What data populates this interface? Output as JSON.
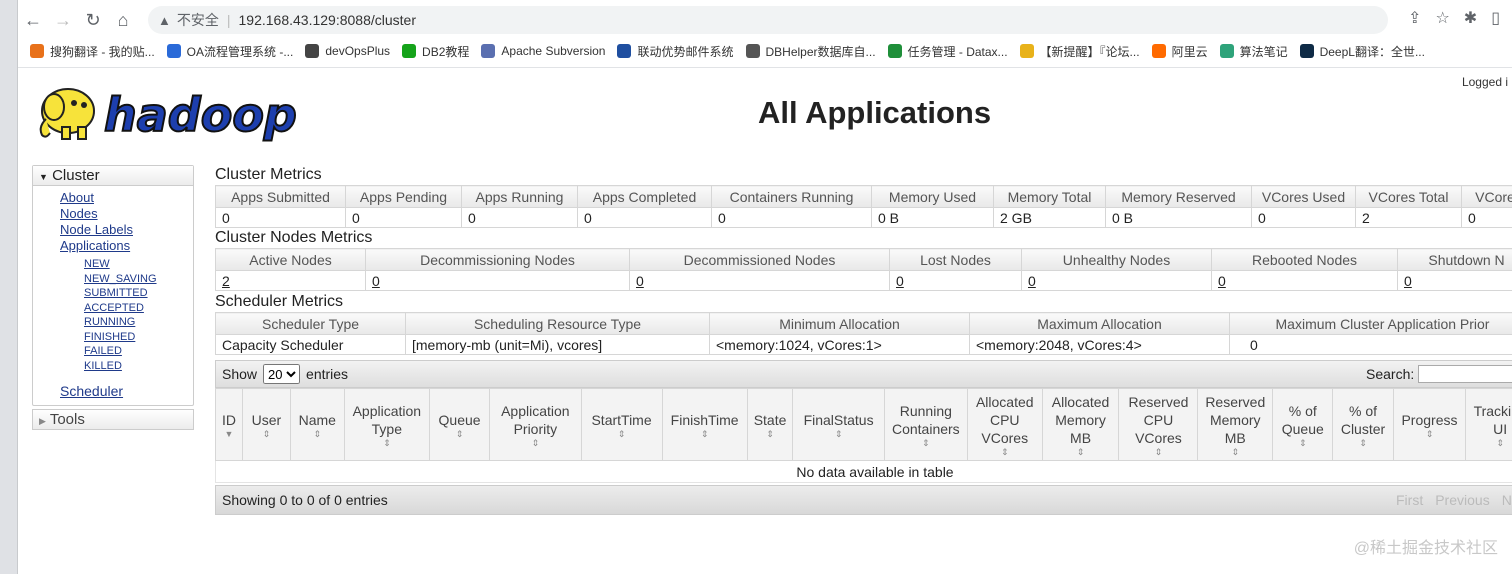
{
  "browser": {
    "security_label": "不安全",
    "url": "192.168.43.129:8088/cluster",
    "bookmarks": [
      {
        "label": "搜狗翻译 - 我的贴...",
        "color": "#e8711a"
      },
      {
        "label": "OA流程管理系统 -...",
        "color": "#2a6ad8"
      },
      {
        "label": "devOpsPlus",
        "color": "#444444"
      },
      {
        "label": "DB2教程",
        "color": "#15a31a"
      },
      {
        "label": "Apache Subversion",
        "color": "#5a6fb0"
      },
      {
        "label": "联动优势邮件系统",
        "color": "#1f4fa0"
      },
      {
        "label": "DBHelper数据库自...",
        "color": "#555555"
      },
      {
        "label": "任务管理 - Datax...",
        "color": "#1f8f3a"
      },
      {
        "label": "【新提醒】『论坛...",
        "color": "#e8b21a"
      },
      {
        "label": "阿里云",
        "color": "#ff6a00"
      },
      {
        "label": "算法笔记",
        "color": "#2ea37a"
      },
      {
        "label": "DeepL翻译：全世...",
        "color": "#0f2b46"
      }
    ]
  },
  "header": {
    "logo_text": "hadoop",
    "logged_in": "Logged i",
    "title": "All Applications"
  },
  "sidebar": {
    "cluster_label": "Cluster",
    "links": [
      "About",
      "Nodes",
      "Node Labels",
      "Applications"
    ],
    "app_states": [
      "NEW",
      "NEW_SAVING",
      "SUBMITTED",
      "ACCEPTED",
      "RUNNING",
      "FINISHED",
      "FAILED",
      "KILLED"
    ],
    "scheduler_label": "Scheduler",
    "tools_label": "Tools"
  },
  "cluster_metrics": {
    "title": "Cluster Metrics",
    "headers": [
      "Apps Submitted",
      "Apps Pending",
      "Apps Running",
      "Apps Completed",
      "Containers Running",
      "Memory Used",
      "Memory Total",
      "Memory Reserved",
      "VCores Used",
      "VCores Total",
      "VCores"
    ],
    "values": [
      "0",
      "0",
      "0",
      "0",
      "0",
      "0 B",
      "2 GB",
      "0 B",
      "0",
      "2",
      "0"
    ]
  },
  "nodes_metrics": {
    "title": "Cluster Nodes Metrics",
    "headers": [
      "Active Nodes",
      "Decommissioning Nodes",
      "Decommissioned Nodes",
      "Lost Nodes",
      "Unhealthy Nodes",
      "Rebooted Nodes",
      "Shutdown N"
    ],
    "values": [
      "2",
      "0",
      "0",
      "0",
      "0",
      "0",
      "0"
    ]
  },
  "scheduler_metrics": {
    "title": "Scheduler Metrics",
    "headers": [
      "Scheduler Type",
      "Scheduling Resource Type",
      "Minimum Allocation",
      "Maximum Allocation",
      "Maximum Cluster Application Prior"
    ],
    "values": [
      "Capacity Scheduler",
      "[memory-mb (unit=Mi), vcores]",
      "<memory:1024, vCores:1>",
      "<memory:2048, vCores:4>",
      "0"
    ]
  },
  "apps_table": {
    "show_label": "Show",
    "page_size": "20",
    "entries_label": "entries",
    "search_label": "Search:",
    "columns": [
      "ID",
      "User",
      "Name",
      "Application Type",
      "Queue",
      "Application Priority",
      "StartTime",
      "FinishTime",
      "State",
      "FinalStatus",
      "Running Containers",
      "Allocated CPU VCores",
      "Allocated Memory MB",
      "Reserved CPU VCores",
      "Reserved Memory MB",
      "% of Queue",
      "% of Cluster",
      "Progress",
      "Tracking UI"
    ],
    "empty_message": "No data available in table",
    "showing": "Showing 0 to 0 of 0 entries",
    "pager": [
      "First",
      "Previous",
      "N"
    ]
  },
  "watermark": "@稀土掘金技术社区"
}
